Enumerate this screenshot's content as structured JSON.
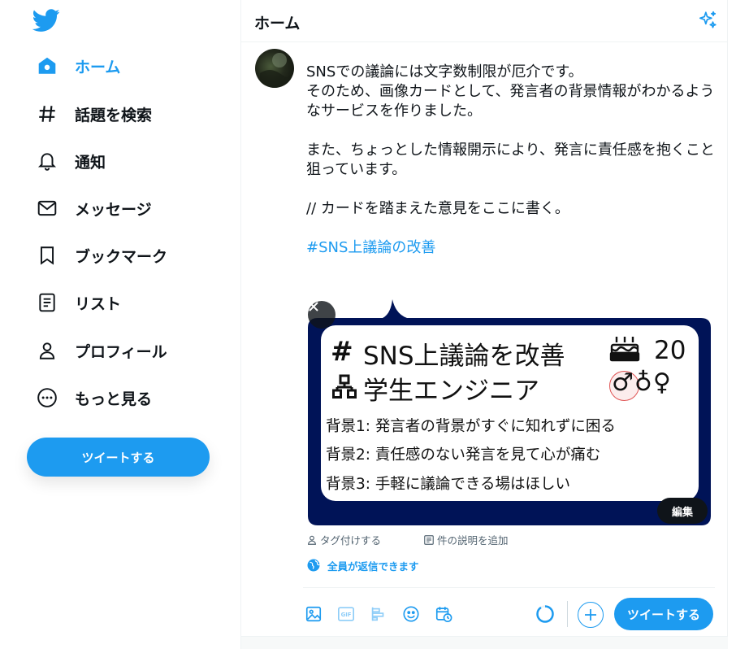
{
  "colors": {
    "accent": "#1d9bf0",
    "text": "#0f1419",
    "muted": "#536471",
    "card_frame": "#001357"
  },
  "sidebar": {
    "logo": "twitter-bird-icon",
    "items": [
      {
        "label": "ホーム",
        "icon": "home-icon",
        "active": true
      },
      {
        "label": "話題を検索",
        "icon": "hashtag-icon"
      },
      {
        "label": "通知",
        "icon": "bell-icon"
      },
      {
        "label": "メッセージ",
        "icon": "envelope-icon"
      },
      {
        "label": "ブックマーク",
        "icon": "bookmark-icon"
      },
      {
        "label": "リスト",
        "icon": "list-icon"
      },
      {
        "label": "プロフィール",
        "icon": "person-icon"
      },
      {
        "label": "もっと見る",
        "icon": "more-circle-icon"
      }
    ],
    "tweet_button": "ツイートする"
  },
  "header": {
    "title": "ホーム",
    "icon": "sparkle-icon"
  },
  "composer": {
    "paragraphs": [
      "SNSでの議論には文字数制限が厄介です。\nそのため、画像カードとして、発言者の背景情報がわかるようなサービスを作りました。",
      "また、ちょっとした情報開示により、発言に責任感を抱くこと狙っています。",
      "// カードを踏まえた意見をここに書く。"
    ],
    "hashtag": "#SNS上議論の改善",
    "card": {
      "hash": "#",
      "title": "SNS上議論を改善",
      "age": "20",
      "occupation": "学生エンジニア",
      "genders": "♂♁♀",
      "background_lines": [
        "背景1: 発言者の背景がすぐに知れずに困る",
        "背景2: 責任感のない発言を見て心が痛む",
        "背景3: 手軽に議論できる場はほしい"
      ],
      "edit_label": "編集"
    },
    "tag_people": "タグ付けする",
    "add_description": "件の説明を追加",
    "reply_setting": "全員が返信できます",
    "toolbar_icons": [
      "image-icon",
      "gif-icon",
      "poll-icon",
      "emoji-icon",
      "schedule-icon"
    ],
    "gif_text": "GIF",
    "tweet_button": "ツイートする"
  }
}
